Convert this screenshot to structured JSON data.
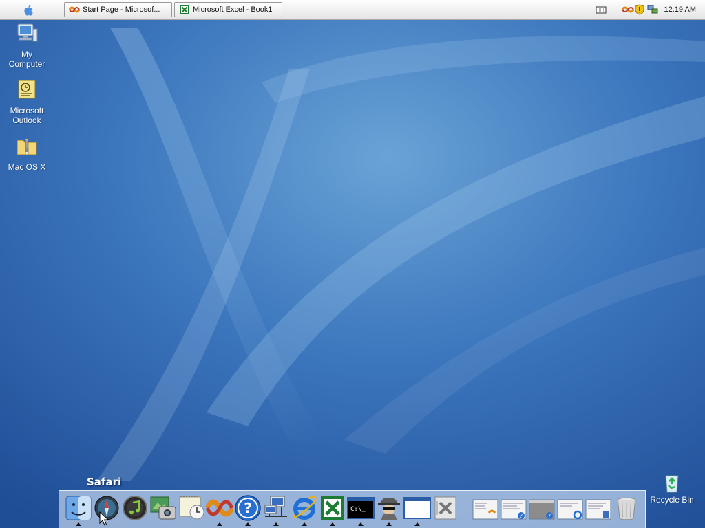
{
  "menubar": {
    "apple_menu": "apple-icon",
    "tasks": [
      {
        "label": "Start Page - Microsof...",
        "icon": "browser-icon"
      },
      {
        "label": "Microsoft Excel - Book1",
        "icon": "excel-icon"
      }
    ],
    "tray": {
      "icons": [
        "keyboard-icon",
        "network-icon",
        "security-shield-icon",
        "connection-icon"
      ],
      "clock": "12:19 AM"
    }
  },
  "desktop": {
    "icons": [
      {
        "label_line1": "My",
        "label_line2": "Computer",
        "icon": "computer-icon"
      },
      {
        "label_line1": "Microsoft",
        "label_line2": "Outlook",
        "icon": "outlook-icon"
      },
      {
        "label_line1": "Mac OS X",
        "label_line2": "",
        "icon": "zip-folder-icon"
      }
    ],
    "recycle_bin": {
      "label": "Recycle Bin",
      "icon": "recycle-bin-icon"
    }
  },
  "dock": {
    "tooltip": "Safari",
    "items": [
      {
        "name": "finder",
        "icon": "finder-icon",
        "running": true
      },
      {
        "name": "safari",
        "icon": "safari-icon",
        "running": false
      },
      {
        "name": "itunes",
        "icon": "itunes-icon",
        "running": false
      },
      {
        "name": "iphoto",
        "icon": "iphoto-icon",
        "running": false
      },
      {
        "name": "ical",
        "icon": "ical-icon",
        "running": false
      },
      {
        "name": "start-page",
        "icon": "browser-icon",
        "running": true
      },
      {
        "name": "help",
        "icon": "help-icon",
        "running": true
      },
      {
        "name": "network",
        "icon": "network-computer-icon",
        "running": true
      },
      {
        "name": "internet-explorer",
        "icon": "ie-icon",
        "running": true
      },
      {
        "name": "excel",
        "icon": "excel-icon",
        "running": true
      },
      {
        "name": "command-prompt",
        "icon": "command-prompt-icon",
        "running": true
      },
      {
        "name": "spy",
        "icon": "spy-icon",
        "running": true
      },
      {
        "name": "window",
        "icon": "window-icon",
        "running": true
      },
      {
        "name": "system-tools",
        "icon": "tools-icon",
        "running": false
      }
    ],
    "minimized": [
      "window-thumbnail-1",
      "window-thumbnail-2",
      "window-thumbnail-3",
      "window-thumbnail-4",
      "window-thumbnail-5"
    ],
    "trash": "trash-icon"
  },
  "colors": {
    "wallpaper": "#2a5fa8",
    "wallpaper_light": "#7fb3dc",
    "dock": "#dce8f8"
  }
}
